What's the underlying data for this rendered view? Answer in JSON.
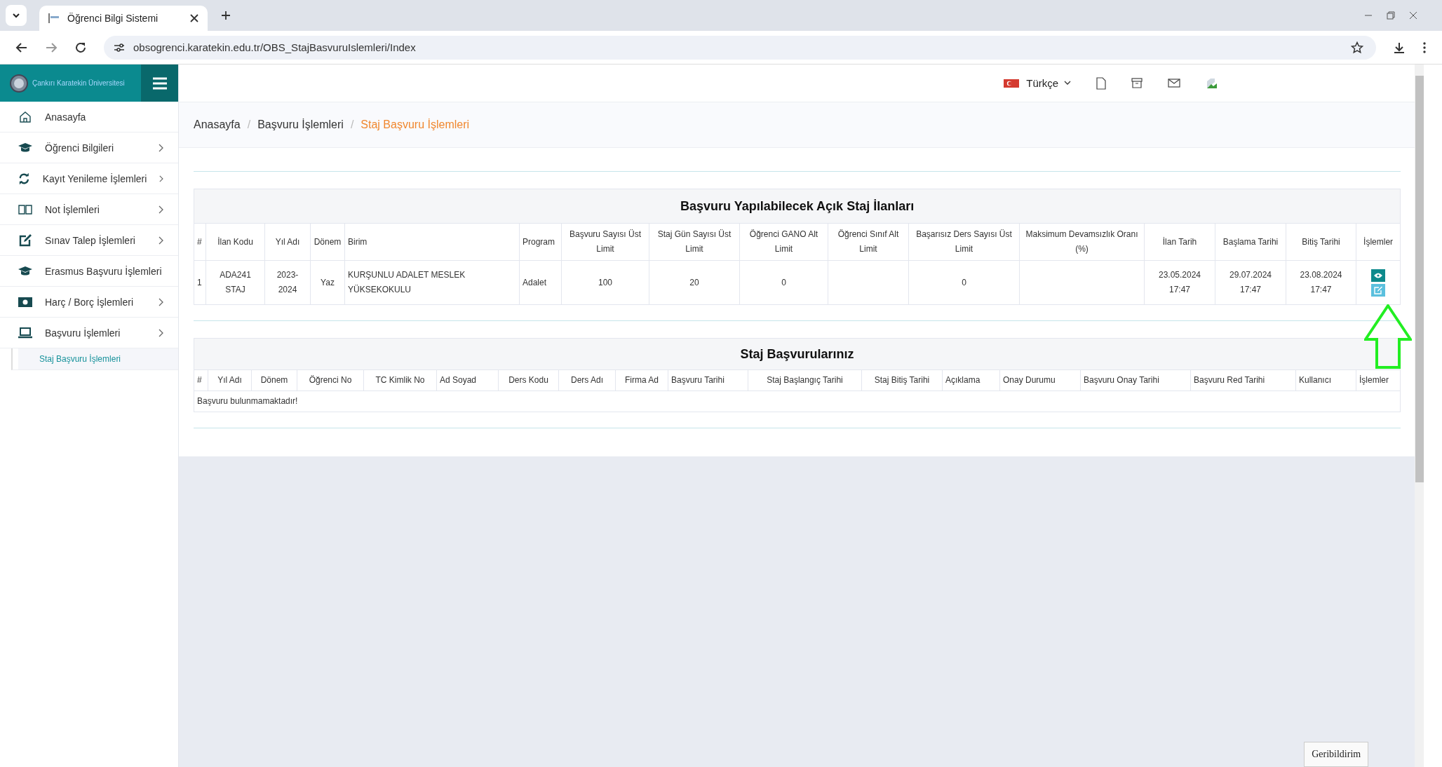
{
  "browser": {
    "tab_title": "Öğrenci Bilgi Sistemi",
    "url": "obsogrenci.karatekin.edu.tr/OBS_StajBasvuruIslemleri/Index"
  },
  "sidebar": {
    "logo_text": "Çankırı Karatekin Üniversitesi",
    "items": [
      {
        "label": "Anasayfa",
        "kind": "home",
        "expandable": false
      },
      {
        "label": "Öğrenci Bilgileri",
        "kind": "cap",
        "expandable": true
      },
      {
        "label": "Kayıt Yenileme İşlemleri",
        "kind": "refresh",
        "expandable": true
      },
      {
        "label": "Not İşlemleri",
        "kind": "book",
        "expandable": true
      },
      {
        "label": "Sınav Talep İşlemleri",
        "kind": "edit",
        "expandable": true
      },
      {
        "label": "Erasmus Başvuru İşlemleri",
        "kind": "cap",
        "expandable": false
      },
      {
        "label": "Harç / Borç İşlemleri",
        "kind": "money",
        "expandable": true
      },
      {
        "label": "Başvuru İşlemleri",
        "kind": "laptop",
        "expandable": true,
        "children": [
          {
            "label": "Staj Başvuru İşlemleri",
            "selected": true
          }
        ]
      }
    ]
  },
  "header": {
    "language": "Türkçe"
  },
  "breadcrumb": {
    "separator": "/",
    "items": [
      {
        "label": "Anasayfa",
        "selected": false
      },
      {
        "label": "Başvuru İşlemleri",
        "selected": false
      },
      {
        "label": "Staj Başvuru İşlemleri",
        "selected": true
      }
    ]
  },
  "postings_table": {
    "title": "Başvuru Yapılabilecek Açık Staj İlanları",
    "columns": [
      "#",
      "İlan Kodu",
      "Yıl Adı",
      "Dönem",
      "Birim",
      "Program",
      "Başvuru Sayısı Üst Limit",
      "Staj Gün Sayısı Üst Limit",
      "Öğrenci GANO Alt Limit",
      "Öğrenci Sınıf Alt Limit",
      "Başarısız Ders Sayısı Üst Limit",
      "Maksimum Devamsızlık Oranı (%)",
      "İlan Tarih",
      "Başlama Tarihi",
      "Bitiş Tarihi",
      "İşlemler"
    ],
    "rows": [
      {
        "cells": [
          "1",
          "ADA241 STAJ",
          "2023-2024",
          "Yaz",
          "KURŞUNLU ADALET MESLEK YÜKSEKOKULU",
          "Adalet",
          "100",
          "20",
          "0",
          null,
          "0",
          null,
          "23.05.2024 17:47",
          "29.07.2024 17:47",
          "23.08.2024 17:47"
        ],
        "actions": [
          {
            "kind": "view"
          },
          {
            "kind": "edit"
          }
        ]
      }
    ]
  },
  "applications_table": {
    "title": "Staj Başvurularınız",
    "columns": [
      "#",
      "Yıl Adı",
      "Dönem",
      "Öğrenci No",
      "TC Kimlik No",
      "Ad Soyad",
      "Ders Kodu",
      "Ders Adı",
      "Firma Ad",
      "Başvuru Tarihi",
      "Staj Başlangıç Tarihi",
      "Staj Bitiş Tarihi",
      "Açıklama",
      "Onay Durumu",
      "Başvuru Onay Tarihi",
      "Başvuru Red Tarihi",
      "Kullanıcı",
      "İşlemler"
    ],
    "empty_message": "Başvuru bulunmamaktadır!"
  },
  "annotation_arrow": {
    "color": "#22ee22"
  },
  "feedback_button": "Geribildirim"
}
